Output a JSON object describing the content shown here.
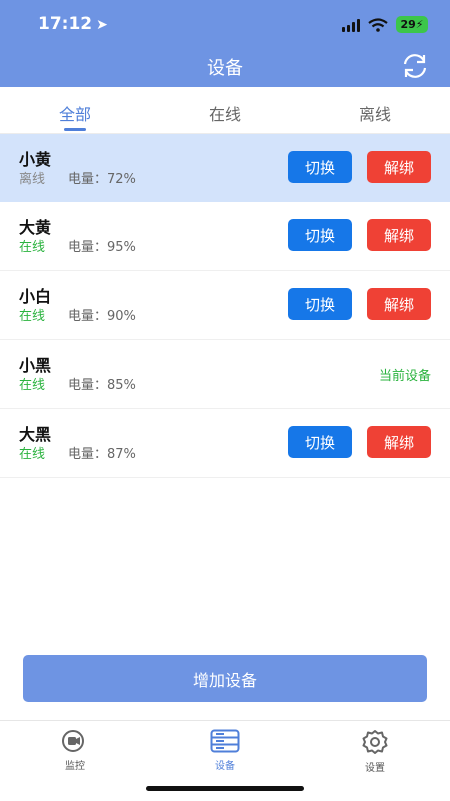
{
  "status_bar": {
    "time": "17:12",
    "battery": "29"
  },
  "header": {
    "title": "设备"
  },
  "tabs": [
    {
      "label": "全部",
      "active": true
    },
    {
      "label": "在线",
      "active": false
    },
    {
      "label": "离线",
      "active": false
    }
  ],
  "devices": [
    {
      "name": "小黄",
      "status": "离线",
      "battery_label": "电量：",
      "battery": "72%",
      "switch_label": "切换",
      "unbind_label": "解绑"
    },
    {
      "name": "大黄",
      "status": "在线",
      "battery_label": "电量：",
      "battery": "95%",
      "switch_label": "切换",
      "unbind_label": "解绑"
    },
    {
      "name": "小白",
      "status": "在线",
      "battery_label": "电量：",
      "battery": "90%",
      "switch_label": "切换",
      "unbind_label": "解绑"
    },
    {
      "name": "小黑",
      "status": "在线",
      "battery_label": "电量：",
      "battery": "85%",
      "current_label": "当前设备"
    },
    {
      "name": "大黑",
      "status": "在线",
      "battery_label": "电量：",
      "battery": "87%",
      "switch_label": "切换",
      "unbind_label": "解绑"
    }
  ],
  "add_button": {
    "label": "增加设备"
  },
  "tabbar": [
    {
      "label": "监控",
      "icon": "camera-icon",
      "active": false
    },
    {
      "label": "设备",
      "icon": "server-icon",
      "active": true
    },
    {
      "label": "设置",
      "icon": "gear-icon",
      "active": false
    }
  ],
  "colors": {
    "header": "#6e94e3",
    "accent": "#4f7fd9",
    "switch_button": "#1677e8",
    "unbind_button": "#ef4135",
    "online": "#2bb33f",
    "selected_row": "#d3e3fb"
  }
}
